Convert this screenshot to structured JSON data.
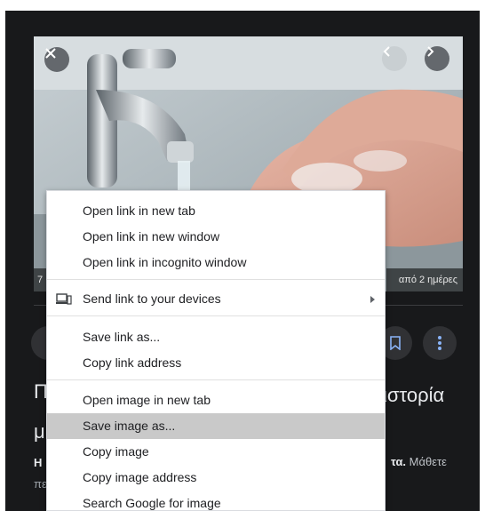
{
  "viewer": {
    "caption_left": "7",
    "caption_right": "από 2 ημέρες",
    "title_line1": "Π",
    "title_line2": "μ",
    "title_right": "ιστορία",
    "desc_line1": "Η",
    "desc_line2": "πε",
    "desc_right_bold": "τα.",
    "desc_right_rest": " Μάθετε"
  },
  "icons": {
    "close": "close-icon",
    "prev": "chevron-left-icon",
    "next": "chevron-right-icon",
    "bookmark": "bookmark-icon",
    "more": "more-vertical-icon",
    "devices": "devices-icon",
    "submenu": "submenu-arrow-icon"
  },
  "context_menu": {
    "open_link_new_tab": "Open link in new tab",
    "open_link_new_window": "Open link in new window",
    "open_link_incognito": "Open link in incognito window",
    "send_link_devices": "Send link to your devices",
    "save_link_as": "Save link as...",
    "copy_link_address": "Copy link address",
    "open_image_new_tab": "Open image in new tab",
    "save_image_as": "Save image as...",
    "copy_image": "Copy image",
    "copy_image_address": "Copy image address",
    "search_google_image": "Search Google for image"
  },
  "colors": {
    "panel_bg": "#18191b",
    "menu_highlight": "#c9c9c9",
    "menu_text": "#202124"
  }
}
